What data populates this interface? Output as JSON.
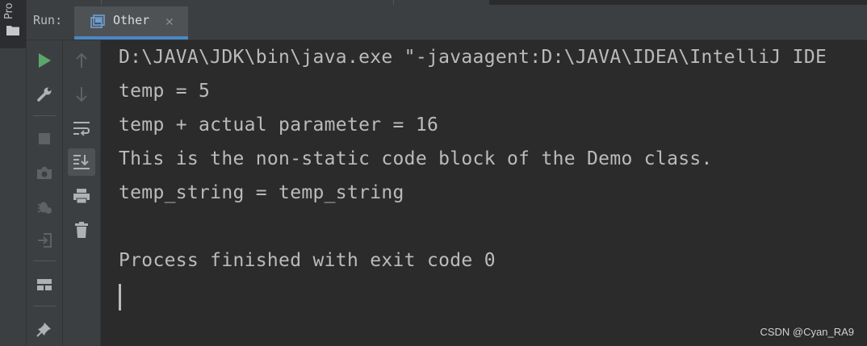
{
  "sidebar": {
    "project_tab_label": "Pro",
    "project_icon": "folder-icon"
  },
  "run_panel": {
    "run_label": "Run:",
    "tab": {
      "label": "Other",
      "icon": "run-config-icon",
      "close_icon": "close-icon"
    }
  },
  "toolbar": {
    "left": [
      "rerun-icon",
      "wrench-icon",
      "stop-icon",
      "camera-icon",
      "debug-icon",
      "exit-icon",
      "layout-icon",
      "pin-icon"
    ],
    "right": [
      "up-arrow-icon",
      "down-arrow-icon",
      "soft-wrap-icon",
      "scroll-to-end-icon",
      "print-icon",
      "trash-icon"
    ]
  },
  "console": {
    "lines": [
      "D:\\JAVA\\JDK\\bin\\java.exe \"-javaagent:D:\\JAVA\\IDEA\\IntelliJ IDE",
      "temp = 5",
      "temp + actual parameter = 16",
      "This is the non-static code block of the Demo class.",
      "temp_string = temp_string",
      "",
      "Process finished with exit code 0"
    ]
  },
  "watermark": "CSDN @Cyan_RA9",
  "colors": {
    "accent": "#4a88c7",
    "run_green": "#59a869",
    "console_text": "#bbbbbb",
    "background": "#2b2b2b"
  }
}
